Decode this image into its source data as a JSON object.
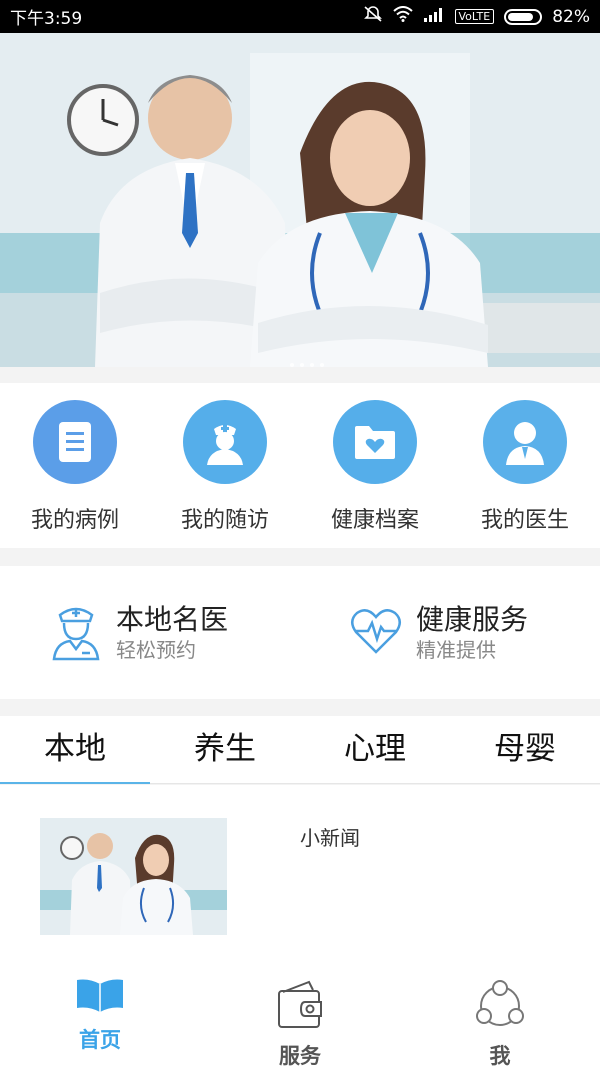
{
  "status_bar": {
    "time": "下午3:59",
    "network": "VoLTE",
    "battery": "82%",
    "battery_level": 0.82
  },
  "banner": {
    "image": "doctors-photo",
    "slide_count": 4
  },
  "quick_menu": [
    {
      "label": "我的病例",
      "icon": "medical-record-icon",
      "color": "#5b9ee8"
    },
    {
      "label": "我的随访",
      "icon": "nurse-icon",
      "color": "#55aeea"
    },
    {
      "label": "健康档案",
      "icon": "health-folder-icon",
      "color": "#55aeea"
    },
    {
      "label": "我的医生",
      "icon": "doctor-icon",
      "color": "#5ab0ea"
    }
  ],
  "services": [
    {
      "title": "本地名医",
      "subtitle": "轻松预约",
      "icon": "doctor-outline-icon"
    },
    {
      "title": "健康服务",
      "subtitle": "精准提供",
      "icon": "heart-pulse-icon"
    }
  ],
  "tabs": [
    "本地",
    "养生",
    "心理",
    "母婴"
  ],
  "active_tab": 0,
  "news": [
    {
      "title": "小新闻",
      "thumbnail": "doctors-thumbnail"
    }
  ],
  "bottom_nav": [
    {
      "label": "首页",
      "icon": "book-icon",
      "active": true,
      "color": "#3aa3e8"
    },
    {
      "label": "服务",
      "icon": "wallet-icon",
      "active": false,
      "color": "#555555"
    },
    {
      "label": "我",
      "icon": "user-circle-icon",
      "active": false,
      "color": "#555555"
    }
  ]
}
